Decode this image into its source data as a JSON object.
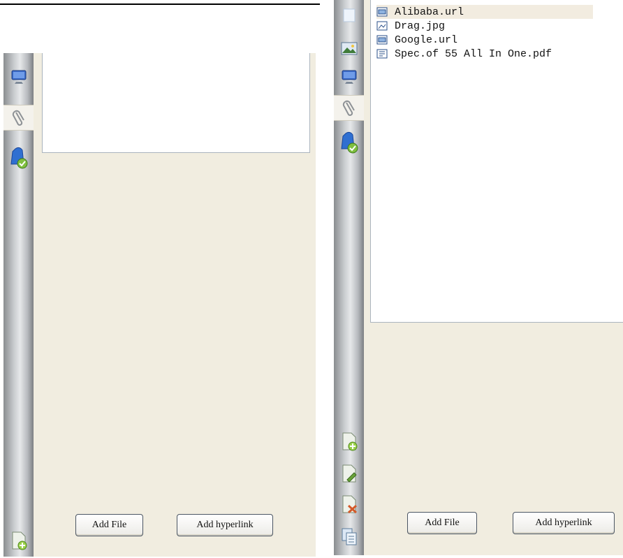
{
  "left_pane": {
    "buttons": {
      "add_file": "Add File",
      "add_hyperlink": "Add hyperlink"
    }
  },
  "right_pane": {
    "files": [
      {
        "name": "Alibaba.url",
        "icon": "url-file-icon"
      },
      {
        "name": "Drag.jpg",
        "icon": "image-file-icon"
      },
      {
        "name": "Google.url",
        "icon": "url-file-icon"
      },
      {
        "name": "Spec.of 55 All In One.pdf",
        "icon": "pdf-file-icon"
      }
    ],
    "buttons": {
      "add_file": "Add File",
      "add_hyperlink": "Add hyperlink"
    }
  },
  "colors": {
    "panel_bg": "#f1ede0",
    "list_border": "#aab4be",
    "highlight": "#f2ece0"
  }
}
